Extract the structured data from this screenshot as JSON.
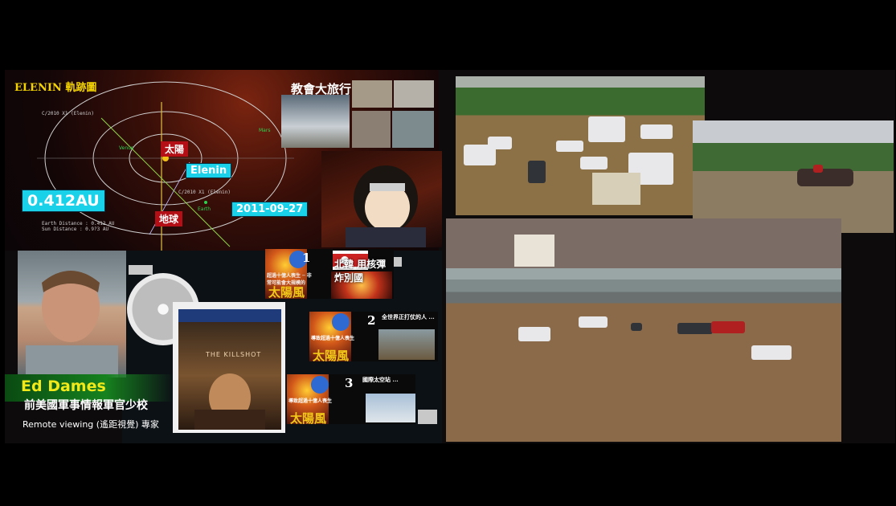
{
  "elenin": {
    "title": "ELENIN 軌跡圖",
    "object_label": "C/2010 X1 (Elenin)",
    "object_label_2": "C/2010 X1 (Elenin)",
    "mars": "Mars",
    "venus": "Venus",
    "earth_small": "Earth",
    "sun_tag": "太陽",
    "earth_tag": "地球",
    "elenin_tag": "Elenin",
    "distance_tag": "0.412AU",
    "earth_distance": "Earth Distance : 0.412 AU",
    "sun_distance": "Sun Distance  : 0.9?3 AU",
    "date_tag": "2011-09-27"
  },
  "tour": {
    "title": "教會大旅行"
  },
  "ed": {
    "name": "Ed Dames",
    "subtitle": "前美國軍事情報軍官少校",
    "role": "Remote viewing (遙距視覺) 專家"
  },
  "dvd": {
    "title": "THE KILLSHOT"
  },
  "news": [
    {
      "number": "1",
      "headline": "北韓 用核彈炸別國",
      "sun": "太陽風",
      "small": "超過十億人喪生 ─ 非常可能會大規模的"
    },
    {
      "number": "2",
      "headline": "全世界正打仗的人 ...",
      "sun": "太陽風",
      "small": "導致超過十億人喪生"
    },
    {
      "number": "3",
      "headline": "國際太空站 ...",
      "sun": "太陽風",
      "small": "導致超過十億人喪生"
    }
  ],
  "colors": {
    "accent_cyan": "#19d1e8",
    "accent_red": "#b40e16",
    "title_yellow": "#f4d400"
  }
}
